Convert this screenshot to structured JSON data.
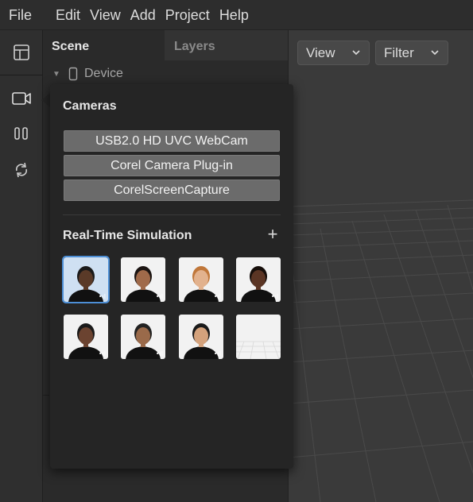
{
  "menubar": {
    "items": [
      "File",
      "Edit",
      "View",
      "Add",
      "Project",
      "Help"
    ]
  },
  "toolbar": {
    "icons": [
      "layout-icon",
      "camera-icon",
      "pause-icon",
      "sync-icon"
    ]
  },
  "scene_panel": {
    "tabs": [
      {
        "label": "Scene",
        "active": true
      },
      {
        "label": "Layers",
        "active": false
      }
    ],
    "tree": {
      "device_label": "Device"
    }
  },
  "viewport": {
    "view_label": "View",
    "filter_label": "Filter"
  },
  "camera_popup": {
    "cameras_title": "Cameras",
    "cameras": [
      "USB2.0 HD UVC WebCam",
      "Corel Camera Plug-in",
      "CorelScreenCapture"
    ],
    "simulation_title": "Real-Time Simulation",
    "add_symbol": "+",
    "avatars": [
      {
        "name": "avatar-1",
        "selected": true,
        "skin": "#5a3a28",
        "hair": "#1a1a1a"
      },
      {
        "name": "avatar-2",
        "selected": false,
        "skin": "#a06a4a",
        "hair": "#1b1412"
      },
      {
        "name": "avatar-3",
        "selected": false,
        "skin": "#e2b28e",
        "hair": "#c0773a"
      },
      {
        "name": "avatar-4",
        "selected": false,
        "skin": "#5b3524",
        "hair": "#160e0a"
      },
      {
        "name": "avatar-5",
        "selected": false,
        "skin": "#6b4330",
        "hair": "#1a1a1a"
      },
      {
        "name": "avatar-6",
        "selected": false,
        "skin": "#9a6a4a",
        "hair": "#222222"
      },
      {
        "name": "avatar-7",
        "selected": false,
        "skin": "#d4a27c",
        "hair": "#1a1a1a"
      },
      {
        "name": "empty-grid",
        "selected": false
      }
    ]
  },
  "colors": {
    "accent": "#4d8fd6",
    "popup_bg": "#252525",
    "button_bg": "#6b6b6b"
  }
}
